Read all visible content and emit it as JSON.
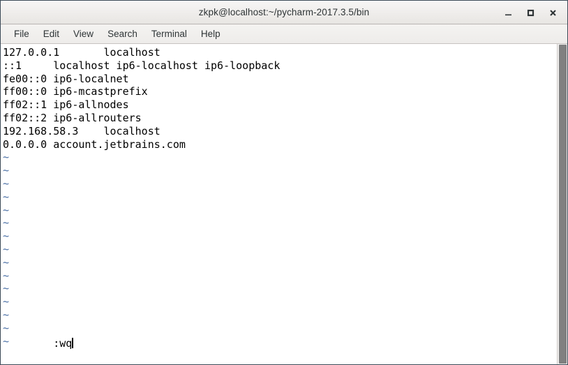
{
  "window": {
    "title": "zkpk@localhost:~/pycharm-2017.3.5/bin",
    "border_color": "#3c4b58",
    "titlebar_color": "#eeecea",
    "controls": [
      {
        "name": "minimize",
        "glyph": "—"
      },
      {
        "name": "maximize",
        "glyph": "□"
      },
      {
        "name": "close",
        "glyph": "✕"
      }
    ]
  },
  "menubar": {
    "items": [
      {
        "label": "File"
      },
      {
        "label": "Edit"
      },
      {
        "label": "View"
      },
      {
        "label": "Search"
      },
      {
        "label": "Terminal"
      },
      {
        "label": "Help"
      }
    ]
  },
  "terminal": {
    "background": "#ffffff",
    "foreground": "#000000",
    "tilde_color": "#4a6fa5",
    "font_size_px": 15,
    "line_height_px": 18.8,
    "lines": [
      "127.0.0.1       localhost",
      "::1     localhost ip6-localhost ip6-loopback",
      "fe00::0 ip6-localnet",
      "ff00::0 ip6-mcastprefix",
      "ff02::1 ip6-allnodes",
      "ff02::2 ip6-allrouters",
      "192.168.58.3    localhost",
      "0.0.0.0 account.jetbrains.com"
    ],
    "empty_line_marker": "~",
    "empty_line_count": 15,
    "status_line": ":wq",
    "cursor_visible": true
  },
  "scrollbar": {
    "track_color": "#f0efee",
    "thumb_color": "#808080",
    "thumb_fraction": 1.0
  }
}
